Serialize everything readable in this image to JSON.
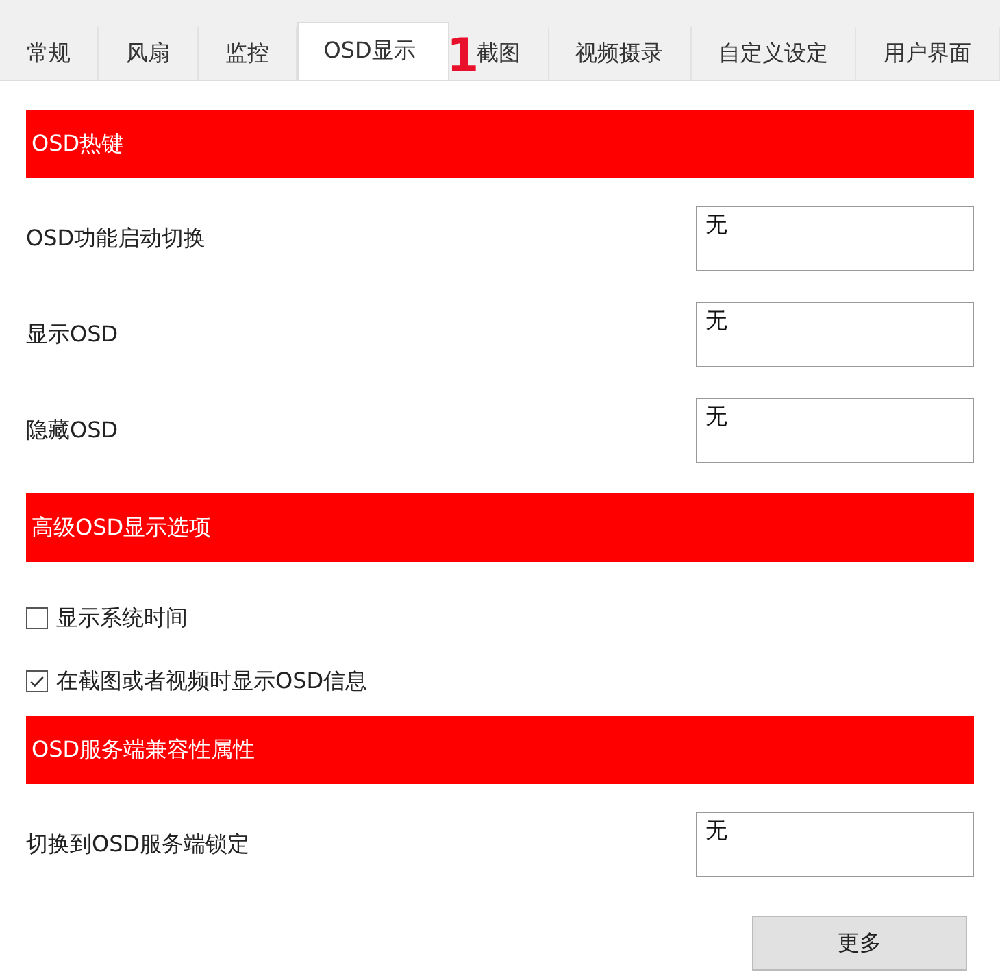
{
  "tabs": [
    {
      "label": "常规",
      "selected": false
    },
    {
      "label": "风扇",
      "selected": false
    },
    {
      "label": "监控",
      "selected": false
    },
    {
      "label": "OSD显示",
      "selected": true
    },
    {
      "label": "截图",
      "selected": false
    },
    {
      "label": "视频摄录",
      "selected": false
    },
    {
      "label": "自定义设定",
      "selected": false
    },
    {
      "label": "用户界面",
      "selected": false
    }
  ],
  "annotation": "1",
  "sections": [
    {
      "title": "OSD热键",
      "items": [
        {
          "kind": "hotkey",
          "label": "OSD功能启动切换",
          "value": "无"
        },
        {
          "kind": "hotkey",
          "label": "显示OSD",
          "value": "无"
        },
        {
          "kind": "hotkey",
          "label": "隐藏OSD",
          "value": "无"
        }
      ]
    },
    {
      "title": "高级OSD显示选项",
      "items": [
        {
          "kind": "checkbox",
          "label": "显示系统时间",
          "checked": false
        },
        {
          "kind": "checkbox",
          "label": "在截图或者视频时显示OSD信息",
          "checked": true
        }
      ]
    },
    {
      "title": "OSD服务端兼容性属性",
      "items": [
        {
          "kind": "hotkey",
          "label": "切换到OSD服务端锁定",
          "value": "无"
        }
      ]
    }
  ],
  "more_button": "更多"
}
